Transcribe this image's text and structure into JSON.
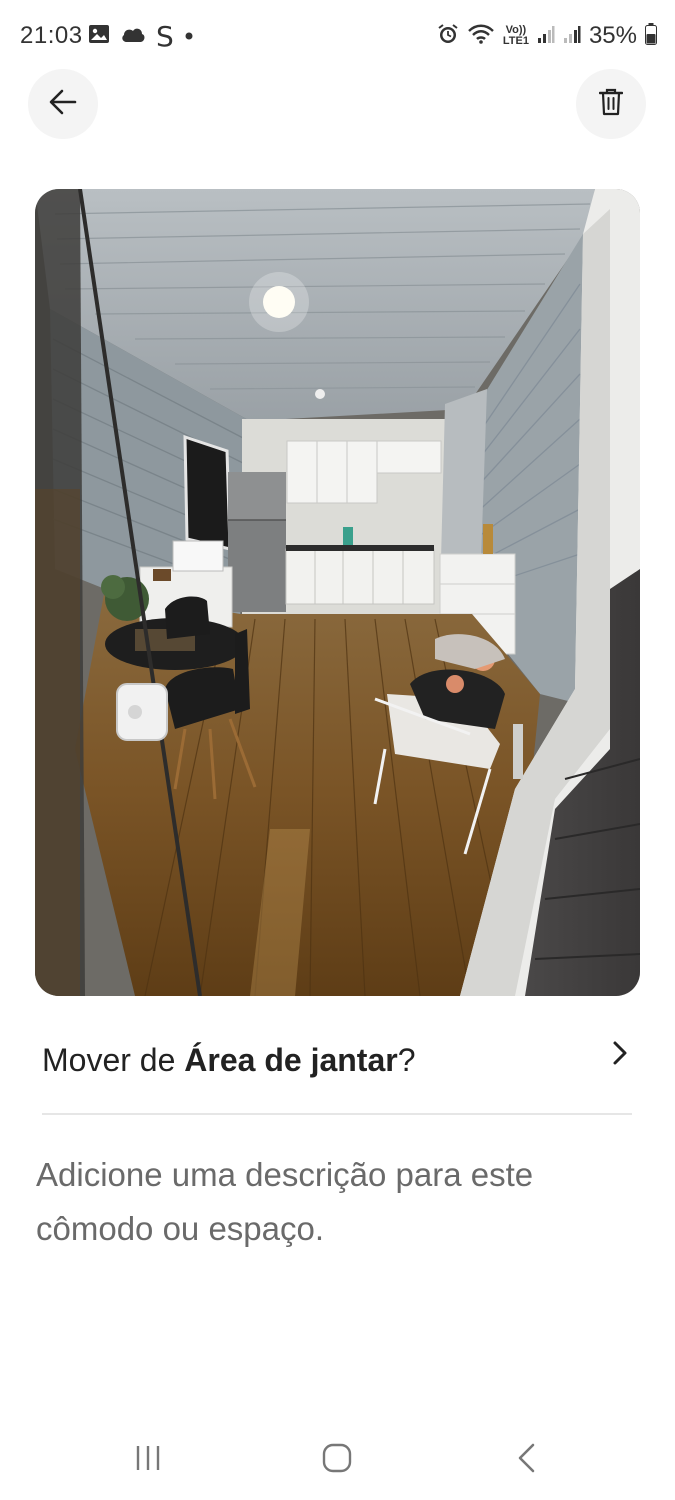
{
  "status_bar": {
    "time": "21:03",
    "left_icons": [
      "gallery-icon",
      "cloud-icon",
      "s-app-icon",
      "dot-icon"
    ],
    "s_glyph": "S",
    "volte_label": "Vo))",
    "lte_label": "LTE1",
    "battery_percent": "35%"
  },
  "header": {
    "back_icon": "arrow-left-icon",
    "trash_icon": "trash-icon"
  },
  "photo": {
    "subject": "room-photo"
  },
  "move_row": {
    "prefix": "Mover de ",
    "room_name": "Área de jantar",
    "suffix": "?",
    "chevron_icon": "chevron-right-icon"
  },
  "description": {
    "placeholder": "Adicione uma descrição para este cômodo ou espaço."
  },
  "nav_bar": {
    "recents_icon": "recents-icon",
    "home_icon": "home-icon",
    "back_icon": "nav-back-icon"
  }
}
